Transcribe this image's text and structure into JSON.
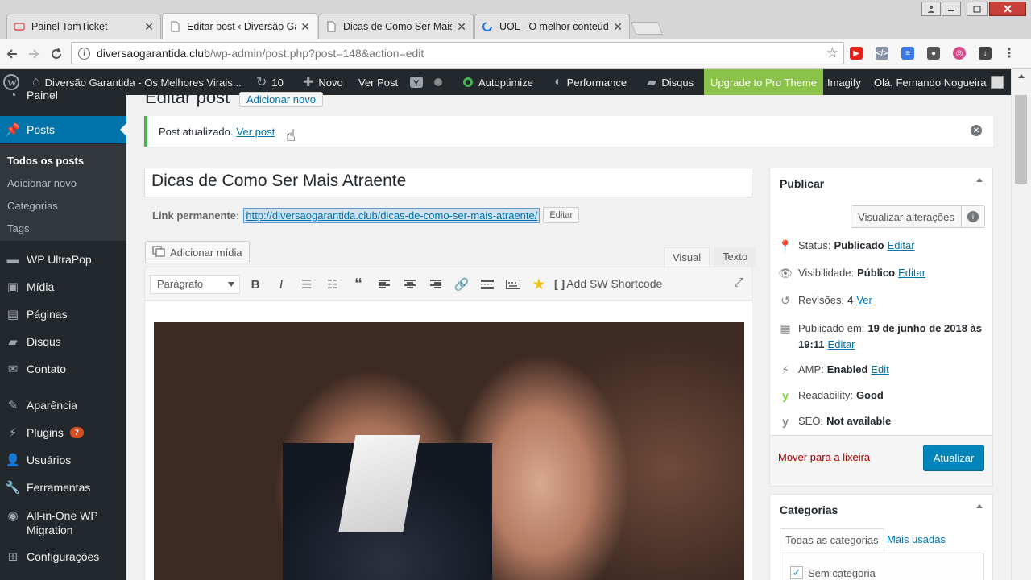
{
  "browser": {
    "tabs": [
      {
        "title": "Painel TomTicket",
        "favicon_color": "#d9534f",
        "active": false
      },
      {
        "title": "Editar post ‹ Diversão Ga",
        "favicon_color": "#777777",
        "active": true
      },
      {
        "title": "Dicas de Como Ser Mais",
        "favicon_color": "#777777",
        "active": false
      },
      {
        "title": "UOL - O melhor conteúd",
        "favicon_color": "#1a73e8",
        "active": false
      }
    ],
    "close_glyph": "✕",
    "url_host": "diversaogarantida.club",
    "url_path": "/wp-admin/post.php?post=148&action=edit"
  },
  "adminbar": {
    "site_name": "Diversão Garantida - Os Melhores Virais...",
    "updates_count": "10",
    "new_label": "Novo",
    "view_post": "Ver Post",
    "autoptimize": "Autoptimize",
    "performance": "Performance",
    "disqus": "Disqus",
    "upgrade": "Upgrade to Pro Theme",
    "imagify": "Imagify",
    "greeting": "Olá, Fernando Nogueira",
    "accent": "#8bc34a"
  },
  "sidebar": {
    "painel": "Painel",
    "posts": "Posts",
    "submenu": [
      "Todos os posts",
      "Adicionar novo",
      "Categorias",
      "Tags"
    ],
    "items": [
      "WP UltraPop",
      "Mídia",
      "Páginas",
      "Disqus",
      "Contato",
      "Aparência",
      "Plugins",
      "Usuários",
      "Ferramentas",
      "All-in-One WP Migration",
      "Configurações"
    ],
    "plugins_badge": "7",
    "accent": "#0073aa"
  },
  "main": {
    "page_title": "Editar post",
    "add_new": "Adicionar novo",
    "notice_text": "Post atualizado.",
    "notice_link": "Ver post",
    "post_title": "Dicas de Como Ser Mais Atraente",
    "permalink_label": "Link permanente:",
    "permalink_url": "http://diversaogarantida.club/dicas-de-como-ser-mais-atraente/",
    "permalink_edit": "Editar",
    "add_media": "Adicionar mídia",
    "tab_visual": "Visual",
    "tab_text": "Texto",
    "format": "Parágrafo",
    "sw_shortcode": "Add SW Shortcode"
  },
  "publish": {
    "title": "Publicar",
    "preview": "Visualizar alterações",
    "status_label": "Status:",
    "status_value": "Publicado",
    "visibility_label": "Visibilidade:",
    "visibility_value": "Público",
    "revisions_label": "Revisões:",
    "revisions_value": "4",
    "revisions_link": "Ver",
    "published_label": "Publicado em:",
    "published_value": "19 de junho de 2018 às 19:11",
    "amp_label": "AMP:",
    "amp_value": "Enabled",
    "amp_link": "Edit",
    "readability_label": "Readability:",
    "readability_value": "Good",
    "seo_label": "SEO:",
    "seo_value": "Not available",
    "edit_link": "Editar",
    "trash": "Mover para a lixeira",
    "update": "Atualizar"
  },
  "categories": {
    "title": "Categorias",
    "tab_all": "Todas as categorias",
    "tab_popular": "Mais usadas",
    "item": "Sem categoria"
  }
}
